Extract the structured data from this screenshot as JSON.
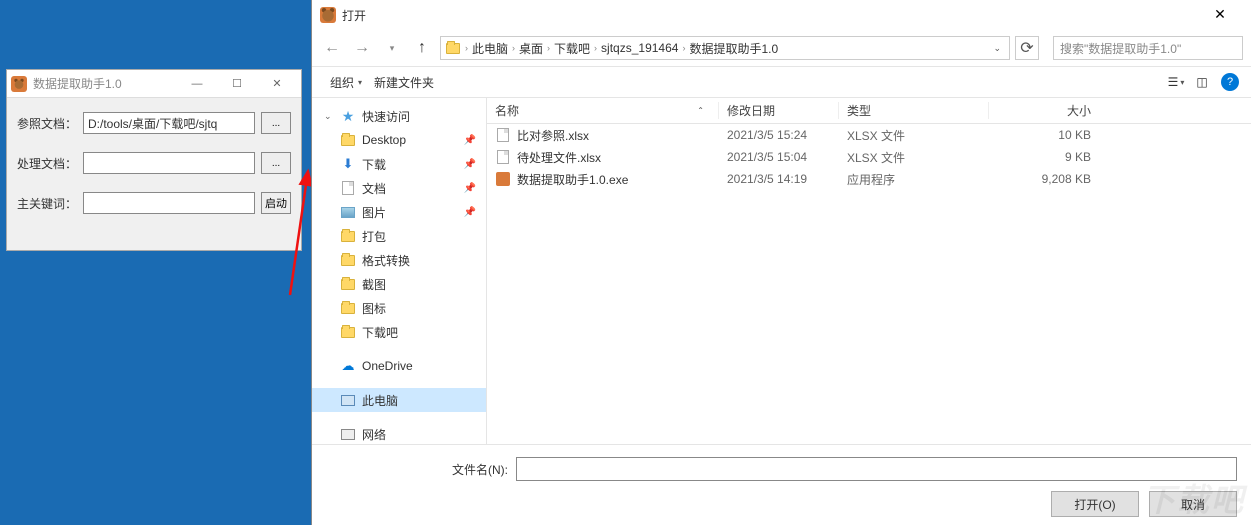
{
  "app": {
    "title": "数据提取助手1.0",
    "labels": {
      "ref": "参照文档：",
      "process": "处理文档：",
      "keyword": "主关键词："
    },
    "values": {
      "ref": "D:/tools/桌面/下载吧/sjtq"
    },
    "browse": "...",
    "start": "启动"
  },
  "dialog": {
    "title": "打开",
    "breadcrumb": {
      "root": "此电脑",
      "p1": "桌面",
      "p2": "下载吧",
      "p3": "sjtqzs_191464",
      "p4": "数据提取助手1.0"
    },
    "search_placeholder": "搜索\"数据提取助手1.0\"",
    "toolbar": {
      "organize": "组织",
      "newfolder": "新建文件夹"
    },
    "tree": {
      "quick": "快速访问",
      "desktop": "Desktop",
      "downloads": "下载",
      "documents": "文档",
      "pictures": "图片",
      "pack": "打包",
      "convert": "格式转换",
      "screenshot": "截图",
      "icons": "图标",
      "xzb": "下载吧",
      "onedrive": "OneDrive",
      "thispc": "此电脑",
      "network": "网络"
    },
    "columns": {
      "name": "名称",
      "date": "修改日期",
      "type": "类型",
      "size": "大小"
    },
    "files": [
      {
        "name": "比对参照.xlsx",
        "date": "2021/3/5 15:24",
        "type": "XLSX 文件",
        "size": "10 KB",
        "ico": "doc"
      },
      {
        "name": "待处理文件.xlsx",
        "date": "2021/3/5 15:04",
        "type": "XLSX 文件",
        "size": "9 KB",
        "ico": "doc"
      },
      {
        "name": "数据提取助手1.0.exe",
        "date": "2021/3/5 14:19",
        "type": "应用程序",
        "size": "9,208 KB",
        "ico": "bear"
      }
    ],
    "filename_label": "文件名(N):",
    "open_btn": "打开(O)",
    "cancel_btn": "取消"
  },
  "watermark": "下载吧"
}
